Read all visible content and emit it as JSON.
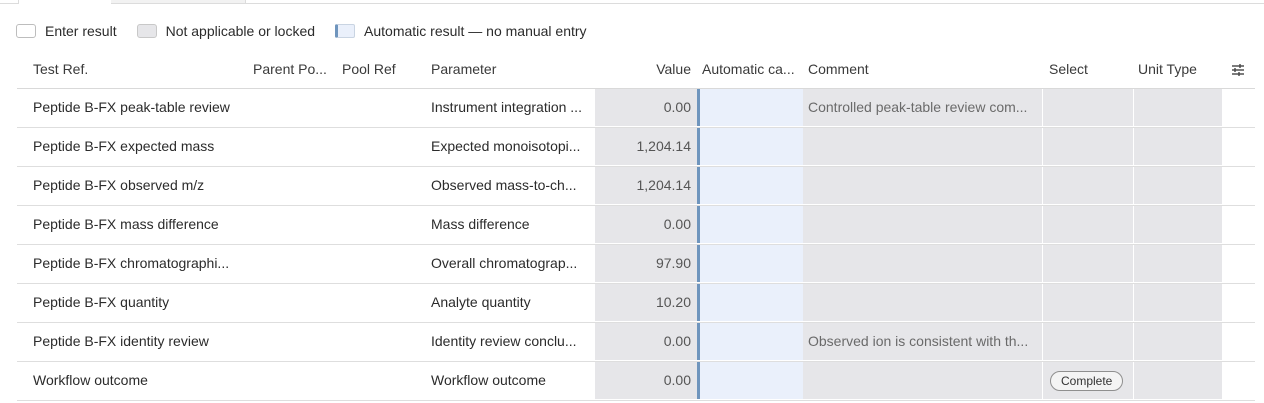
{
  "legend": [
    {
      "label": "Enter result",
      "style": "enter"
    },
    {
      "label": "Not applicable or locked",
      "style": "na"
    },
    {
      "label": "Automatic result — no manual entry",
      "style": "auto"
    }
  ],
  "columns": {
    "test_ref": "Test Ref.",
    "parent": "Parent Po...",
    "pool_ref": "Pool Ref",
    "parameter": "Parameter",
    "value": "Value",
    "automatic": "Automatic ca...",
    "comment": "Comment",
    "select": "Select",
    "unit_type": "Unit Type"
  },
  "column_menu_icon": "sliders-icon",
  "colors": {
    "locked_fill": "#e6e6e9",
    "auto_fill": "#eaf0fb",
    "auto_border": "#6f95bd"
  },
  "rows": [
    {
      "test_ref": "Peptide B-FX peak-table review",
      "parent": "",
      "pool_ref": "",
      "parameter": "Instrument integration ...",
      "value": "0.00",
      "comment": "Controlled peak-table review com...",
      "select": "",
      "unit_type": ""
    },
    {
      "test_ref": "Peptide B-FX expected mass",
      "parent": "",
      "pool_ref": "",
      "parameter": "Expected monoisotopi...",
      "value": "1,204.14",
      "comment": "",
      "select": "",
      "unit_type": ""
    },
    {
      "test_ref": "Peptide B-FX observed m/z",
      "parent": "",
      "pool_ref": "",
      "parameter": "Observed mass-to-ch...",
      "value": "1,204.14",
      "comment": "",
      "select": "",
      "unit_type": ""
    },
    {
      "test_ref": "Peptide B-FX mass difference",
      "parent": "",
      "pool_ref": "",
      "parameter": "Mass difference",
      "value": "0.00",
      "comment": "",
      "select": "",
      "unit_type": ""
    },
    {
      "test_ref": "Peptide B-FX chromatographi...",
      "parent": "",
      "pool_ref": "",
      "parameter": "Overall chromatograp...",
      "value": "97.90",
      "comment": "",
      "select": "",
      "unit_type": ""
    },
    {
      "test_ref": "Peptide B-FX quantity",
      "parent": "",
      "pool_ref": "",
      "parameter": "Analyte quantity",
      "value": "10.20",
      "comment": "",
      "select": "",
      "unit_type": ""
    },
    {
      "test_ref": "Peptide B-FX identity review",
      "parent": "",
      "pool_ref": "",
      "parameter": "Identity review conclu...",
      "value": "0.00",
      "comment": "Observed ion is consistent with th...",
      "select": "",
      "unit_type": ""
    },
    {
      "test_ref": "Workflow outcome",
      "parent": "",
      "pool_ref": "",
      "parameter": "Workflow outcome",
      "value": "0.00",
      "comment": "",
      "select": "Complete",
      "unit_type": ""
    }
  ]
}
